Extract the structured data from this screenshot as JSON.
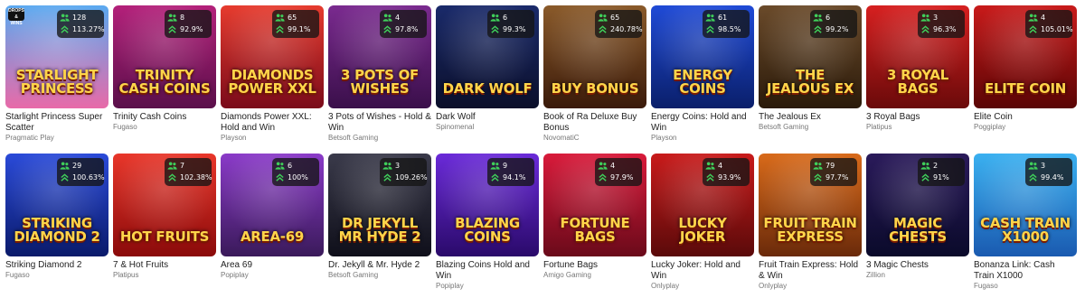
{
  "games": [
    {
      "name": "Starlight Princess Super Scatter",
      "provider": "Pragmatic Play",
      "players": "128",
      "rtp": "113.27%",
      "art_title": "Starlight Princess",
      "bg_top": "#5aa9f0",
      "bg_bottom": "#e86aa8",
      "corner_tag": "DROPS & WINS"
    },
    {
      "name": "Trinity Cash Coins",
      "provider": "Fugaso",
      "players": "8",
      "rtp": "92.9%",
      "art_title": "TRINITY CASH COINS",
      "bg_top": "#b3207a",
      "bg_bottom": "#5a0f4a"
    },
    {
      "name": "Diamonds Power XXL: Hold and Win",
      "provider": "Playson",
      "players": "65",
      "rtp": "99.1%",
      "art_title": "DIAMONDS POWER XXL",
      "bg_top": "#e63b2e",
      "bg_bottom": "#7a0b1a"
    },
    {
      "name": "3 Pots of Wishes - Hold & Win",
      "provider": "Betsoft Gaming",
      "players": "4",
      "rtp": "97.8%",
      "art_title": "3 POTS OF WISHES",
      "bg_top": "#7a2a8f",
      "bg_bottom": "#3a0f4a"
    },
    {
      "name": "Dark Wolf",
      "provider": "Spinomenal",
      "players": "6",
      "rtp": "99.3%",
      "art_title": "DARK WOLF",
      "bg_top": "#1a2a6a",
      "bg_bottom": "#0b0f2a"
    },
    {
      "name": "Book of Ra Deluxe Buy Bonus",
      "provider": "NovomatiC",
      "players": "65",
      "rtp": "240.78%",
      "art_title": "BUY BONUS",
      "bg_top": "#8a5a2a",
      "bg_bottom": "#3a1a0a"
    },
    {
      "name": "Energy Coins: Hold and Win",
      "provider": "Playson",
      "players": "61",
      "rtp": "98.5%",
      "art_title": "ENERGY COINS",
      "bg_top": "#1f4ad6",
      "bg_bottom": "#0a1f6a"
    },
    {
      "name": "The Jealous Ex",
      "provider": "Betsoft Gaming",
      "players": "6",
      "rtp": "99.2%",
      "art_title": "THE JEALOUS EX",
      "bg_top": "#6a4a2a",
      "bg_bottom": "#2a1a0a"
    },
    {
      "name": "3 Royal Bags",
      "provider": "Platipus",
      "players": "3",
      "rtp": "96.3%",
      "art_title": "3 ROYAL BAGS",
      "bg_top": "#d62020",
      "bg_bottom": "#6a0a0a"
    },
    {
      "name": "Elite Coin",
      "provider": "Poggiplay",
      "players": "4",
      "rtp": "105.01%",
      "art_title": "ELITE COIN",
      "bg_top": "#c81a1a",
      "bg_bottom": "#5a0505"
    },
    {
      "name": "Striking Diamond 2",
      "provider": "Fugaso",
      "players": "29",
      "rtp": "100.63%",
      "art_title": "STRIKING DIAMOND 2",
      "bg_top": "#2a4ad8",
      "bg_bottom": "#0a1a6a"
    },
    {
      "name": "7 & Hot Fruits",
      "provider": "Platipus",
      "players": "7",
      "rtp": "102.38%",
      "art_title": "HOT FRUITS",
      "bg_top": "#e8362a",
      "bg_bottom": "#8a0a0a"
    },
    {
      "name": "Area 69",
      "provider": "Popiplay",
      "players": "6",
      "rtp": "100%",
      "art_title": "AREA-69",
      "bg_top": "#8a3ac8",
      "bg_bottom": "#3a1a5a"
    },
    {
      "name": "Dr. Jekyll & Mr. Hyde 2",
      "provider": "Betsoft Gaming",
      "players": "3",
      "rtp": "109.26%",
      "art_title": "DR JEKYLL MR HYDE 2",
      "bg_top": "#3a3a4a",
      "bg_bottom": "#0f0f1a"
    },
    {
      "name": "Blazing Coins Hold and Win",
      "provider": "Popiplay",
      "players": "9",
      "rtp": "94.1%",
      "art_title": "BLAZING COINS",
      "bg_top": "#6a2ad8",
      "bg_bottom": "#2a0a6a"
    },
    {
      "name": "Fortune Bags",
      "provider": "Amigo Gaming",
      "players": "4",
      "rtp": "97.9%",
      "art_title": "FORTUNE BAGS",
      "bg_top": "#d81a3a",
      "bg_bottom": "#6a0a1a"
    },
    {
      "name": "Lucky Joker: Hold and Win",
      "provider": "Onlyplay",
      "players": "4",
      "rtp": "93.9%",
      "art_title": "LUCKY JOKER",
      "bg_top": "#c81a1a",
      "bg_bottom": "#5a0a0a"
    },
    {
      "name": "Fruit Train Express: Hold & Win",
      "provider": "Onlyplay",
      "players": "79",
      "rtp": "97.7%",
      "art_title": "FRUIT TRAIN EXPRESS",
      "bg_top": "#d86a1a",
      "bg_bottom": "#6a2a0a"
    },
    {
      "name": "3 Magic Chests",
      "provider": "Zillion",
      "players": "2",
      "rtp": "91%",
      "art_title": "MAGIC CHESTS",
      "bg_top": "#2a1a5a",
      "bg_bottom": "#0a0a2a"
    },
    {
      "name": "Bonanza Link: Cash Train X1000",
      "provider": "Fugaso",
      "players": "3",
      "rtp": "99.4%",
      "art_title": "CASH TRAIN X1000",
      "bg_top": "#3ab0f0",
      "bg_bottom": "#1a5ab0"
    }
  ],
  "colors": {
    "badge_icon": "#3fcf5a",
    "name_text": "#222222",
    "provider_text": "#777777"
  },
  "icons": {
    "players": "users-icon",
    "rtp": "chevrons-up-icon"
  }
}
